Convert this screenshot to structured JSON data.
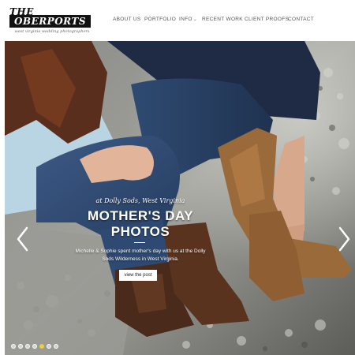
{
  "header": {
    "logo_line1": "THE",
    "logo_line2": "OBERPORTS",
    "logo_tagline": "west virginia wedding photographers"
  },
  "nav": {
    "items": [
      {
        "label": "ABOUT US"
      },
      {
        "label": "PORTFOLIO"
      },
      {
        "label": "INFO",
        "has_dropdown": true
      },
      {
        "label": "RECENT WORK"
      },
      {
        "label": "CLIENT PROOFS"
      },
      {
        "label": "CONTACT"
      }
    ],
    "dropdown_icon": "chevron-down-icon"
  },
  "slider": {
    "location": "at Dolly Sods, West Virginia",
    "title_line1": "MOTHER'S DAY",
    "title_line2": "PHOTOS",
    "description": "Michelle & Sophie spent mother's day with us at the Dolly Sods Wilderness in West Virginia.",
    "button_label": "view the post",
    "prev_icon": "chevron-left-icon",
    "next_icon": "chevron-right-icon",
    "slide_count": 7,
    "active_slide": 5,
    "active_dot_color": "#e8cf3b"
  }
}
